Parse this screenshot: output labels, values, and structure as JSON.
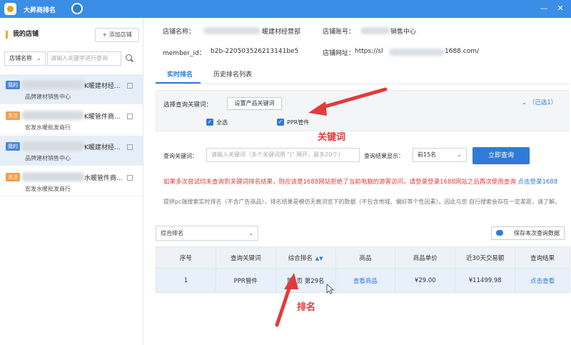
{
  "app": {
    "title": "大昇商排名",
    "window_controls": [
      "—",
      "✕"
    ]
  },
  "sidebar": {
    "title": "我的店铺",
    "add_button": "+ 添加店铺",
    "filter_select": "店铺名称",
    "search_placeholder": "请输入关键字进行查询",
    "shops": [
      {
        "tag": "我的",
        "name": "K暖建材经...",
        "sub": "品牌建材销售中心",
        "active": true
      },
      {
        "tag": "关注",
        "name": "K暖管件商...",
        "sub": "宏发水暖批发商行",
        "active": false
      },
      {
        "tag": "我的",
        "name": "K暖建材经...",
        "sub": "品牌建材销售中心",
        "active": true
      },
      {
        "tag": "关注",
        "name": "水暖管件商...",
        "sub": "宏发水暖批发商行",
        "active": false
      }
    ]
  },
  "shop_info": {
    "name_label": "店铺名称：",
    "name_value": "暖建材经营部",
    "account_label": "店铺账号：",
    "account_value": "销售中心",
    "member_label": "member_id：",
    "member_value": "b2b-220503526213141be5",
    "url_label": "店铺网址：",
    "url_prefix": "https://sl",
    "url_suffix": "1688.com/"
  },
  "tabs": [
    "实时排名",
    "历史排名列表"
  ],
  "keyword_panel": {
    "label": "选择查询关键词：",
    "set_button": "设置产品关键词",
    "selected_count": "（已选1）",
    "select_all": "全选",
    "keyword": "PPR管件"
  },
  "query": {
    "keyword_label": "查询关键词：",
    "keyword_placeholder": "请输入关键词（多个关键词用 \"|\" 隔开，最多20个）",
    "result_label": "查询结果显示：",
    "result_value": "前15名",
    "query_button": "立即查询"
  },
  "warning": {
    "text": "如果多次尝试均未查询到关键词排名结果，则应该是1688网站拒绝了当前电脑的游客访问，请登录登录1688网站之后再次使用查询",
    "link": "点击登录1688"
  },
  "tip": "提供pc端搜索实时排名（不含广告商品），排名结果是模仿无痕浏览下的数据（不包含地域、偏好等个性因素）。因此与您 自行搜索会存在一定差距，请了解。",
  "sort_select": "综合排名",
  "save_button": "保存本次查询数据",
  "table": {
    "headers": [
      "序号",
      "查询关键词",
      "综合排名",
      "商品",
      "商品单价",
      "近30天交易额",
      "查询结果"
    ],
    "rows": [
      [
        "1",
        "PPR管件",
        "第1页 第29名",
        "查看商品",
        "¥29.00",
        "¥11499.98",
        "点击查看"
      ]
    ]
  },
  "annotations": {
    "keyword": "关键词",
    "rank": "排名"
  },
  "colors": {
    "titlebar": "#3a8ee6",
    "primary": "#2f7bd8",
    "warning": "#e23b3b",
    "accent": "#f5a623"
  }
}
